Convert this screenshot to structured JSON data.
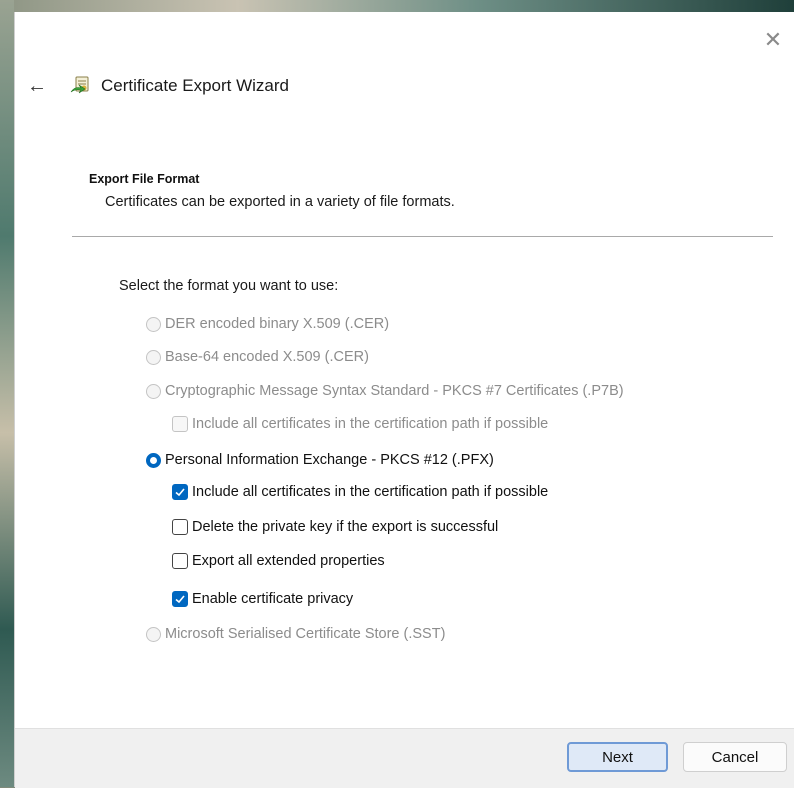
{
  "window": {
    "title": "Certificate Export Wizard",
    "close_glyph": "✕",
    "back_glyph": "←"
  },
  "section": {
    "heading": "Export File Format",
    "description": "Certificates can be exported in a variety of file formats."
  },
  "format_prompt": "Select the format you want to use:",
  "options": {
    "der": {
      "label": "DER encoded binary X.509 (.CER)",
      "selected": false,
      "enabled": false
    },
    "base64": {
      "label": "Base-64 encoded X.509 (.CER)",
      "selected": false,
      "enabled": false
    },
    "pkcs7": {
      "label": "Cryptographic Message Syntax Standard - PKCS #7 Certificates (.P7B)",
      "selected": false,
      "enabled": false
    },
    "pkcs7_include": {
      "label": "Include all certificates in the certification path if possible",
      "checked": false,
      "enabled": false
    },
    "pfx": {
      "label": "Personal Information Exchange - PKCS #12 (.PFX)",
      "selected": true,
      "enabled": true
    },
    "pfx_include": {
      "label": "Include all certificates in the certification path if possible",
      "checked": true,
      "enabled": true
    },
    "pfx_delete_key": {
      "label": "Delete the private key if the export is successful",
      "checked": false,
      "enabled": true
    },
    "pfx_export_props": {
      "label": "Export all extended properties",
      "checked": false,
      "enabled": true
    },
    "pfx_privacy": {
      "label": "Enable certificate privacy",
      "checked": true,
      "enabled": true
    },
    "sst": {
      "label": "Microsoft Serialised Certificate Store (.SST)",
      "selected": false,
      "enabled": false
    }
  },
  "buttons": {
    "next": "Next",
    "cancel": "Cancel"
  },
  "colors": {
    "accent": "#0067c0",
    "disabled_text": "#8c8c8c",
    "footer_bg": "#f0f0f0"
  },
  "icons": {
    "wizard": "certificate-icon",
    "back": "back-arrow-icon",
    "close": "close-icon"
  }
}
